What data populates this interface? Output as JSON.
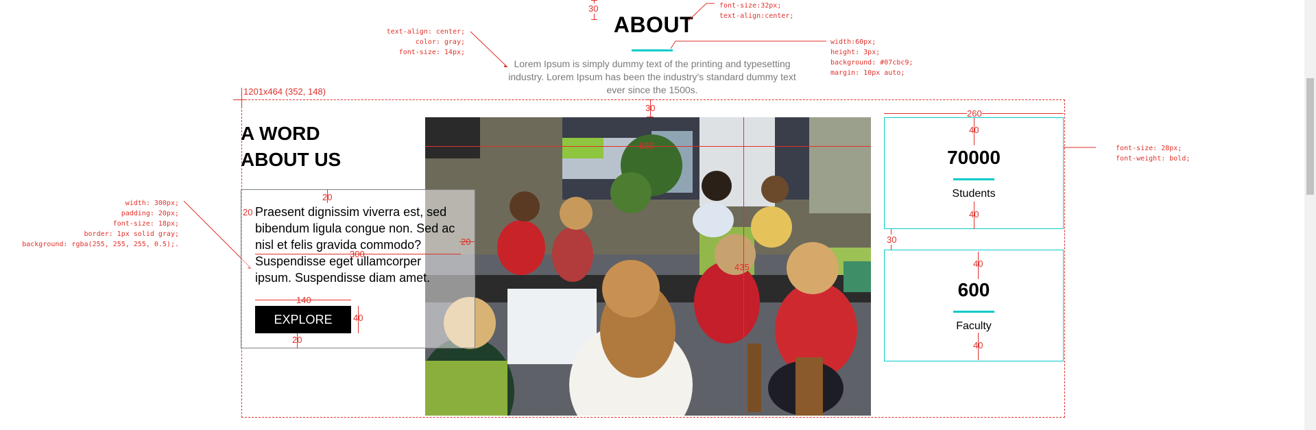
{
  "about": {
    "title": "ABOUT",
    "text": "Lorem Ipsum is simply dummy text of the printing and typesetting industry. Lorem Ipsum has been the industry's standard dummy text ever since the 1500s."
  },
  "section": {
    "word_title_line1": "A WORD",
    "word_title_line2": "ABOUT US",
    "body_text": "Praesent dignissim viverra est, sed bibendum ligula congue non. Sed ac nisl et felis gravida commodo? Suspendisse eget ullamcorper ipsum. Suspendisse diam amet.",
    "button_label": "EXPLORE",
    "photo_icon": "classroom-photo"
  },
  "stats": [
    {
      "number": "70000",
      "label": "Students"
    },
    {
      "number": "600",
      "label": "Faculty"
    }
  ],
  "annotations": {
    "top_spacing": "30",
    "title_css_1": "font-size:32px;",
    "title_css_2": "text-align:center;",
    "text_css_1": "text-align: center;",
    "text_css_2": "color: gray;",
    "text_css_3": "font-size: 14px;",
    "bar_css_1": "width:60px;",
    "bar_css_2": "height: 3px;",
    "bar_css_3": "background: #07cbc9;",
    "bar_css_4": "margin: 10px auto;",
    "container_label": "1201x464 (352, 148)",
    "box_css_1": "width: 300px;",
    "box_css_2": "padding: 20px;",
    "box_css_3": "font-size: 18px;",
    "box_css_4": "border: 1px solid gray;",
    "box_css_5": "background: rgba(255, 255, 255, 0.5);.",
    "stat_css_1": "font-size: 28px;",
    "stat_css_2": "font-weight: bold;",
    "dim_30_photo": "30",
    "dim_650": "650",
    "dim_435": "435",
    "dim_260": "260",
    "dim_40_a": "40",
    "dim_40_b": "40",
    "dim_30_gap": "30",
    "dim_40_c": "40",
    "dim_40_d": "40",
    "dim_20_top": "20",
    "dim_20_left": "20",
    "dim_20_right": "20",
    "dim_300": "300",
    "dim_140": "140",
    "dim_40_btn": "40",
    "dim_20_bottom": "20"
  },
  "colors": {
    "accent": "#07cbc9",
    "annotation": "#e0302a",
    "button": "#000000"
  }
}
